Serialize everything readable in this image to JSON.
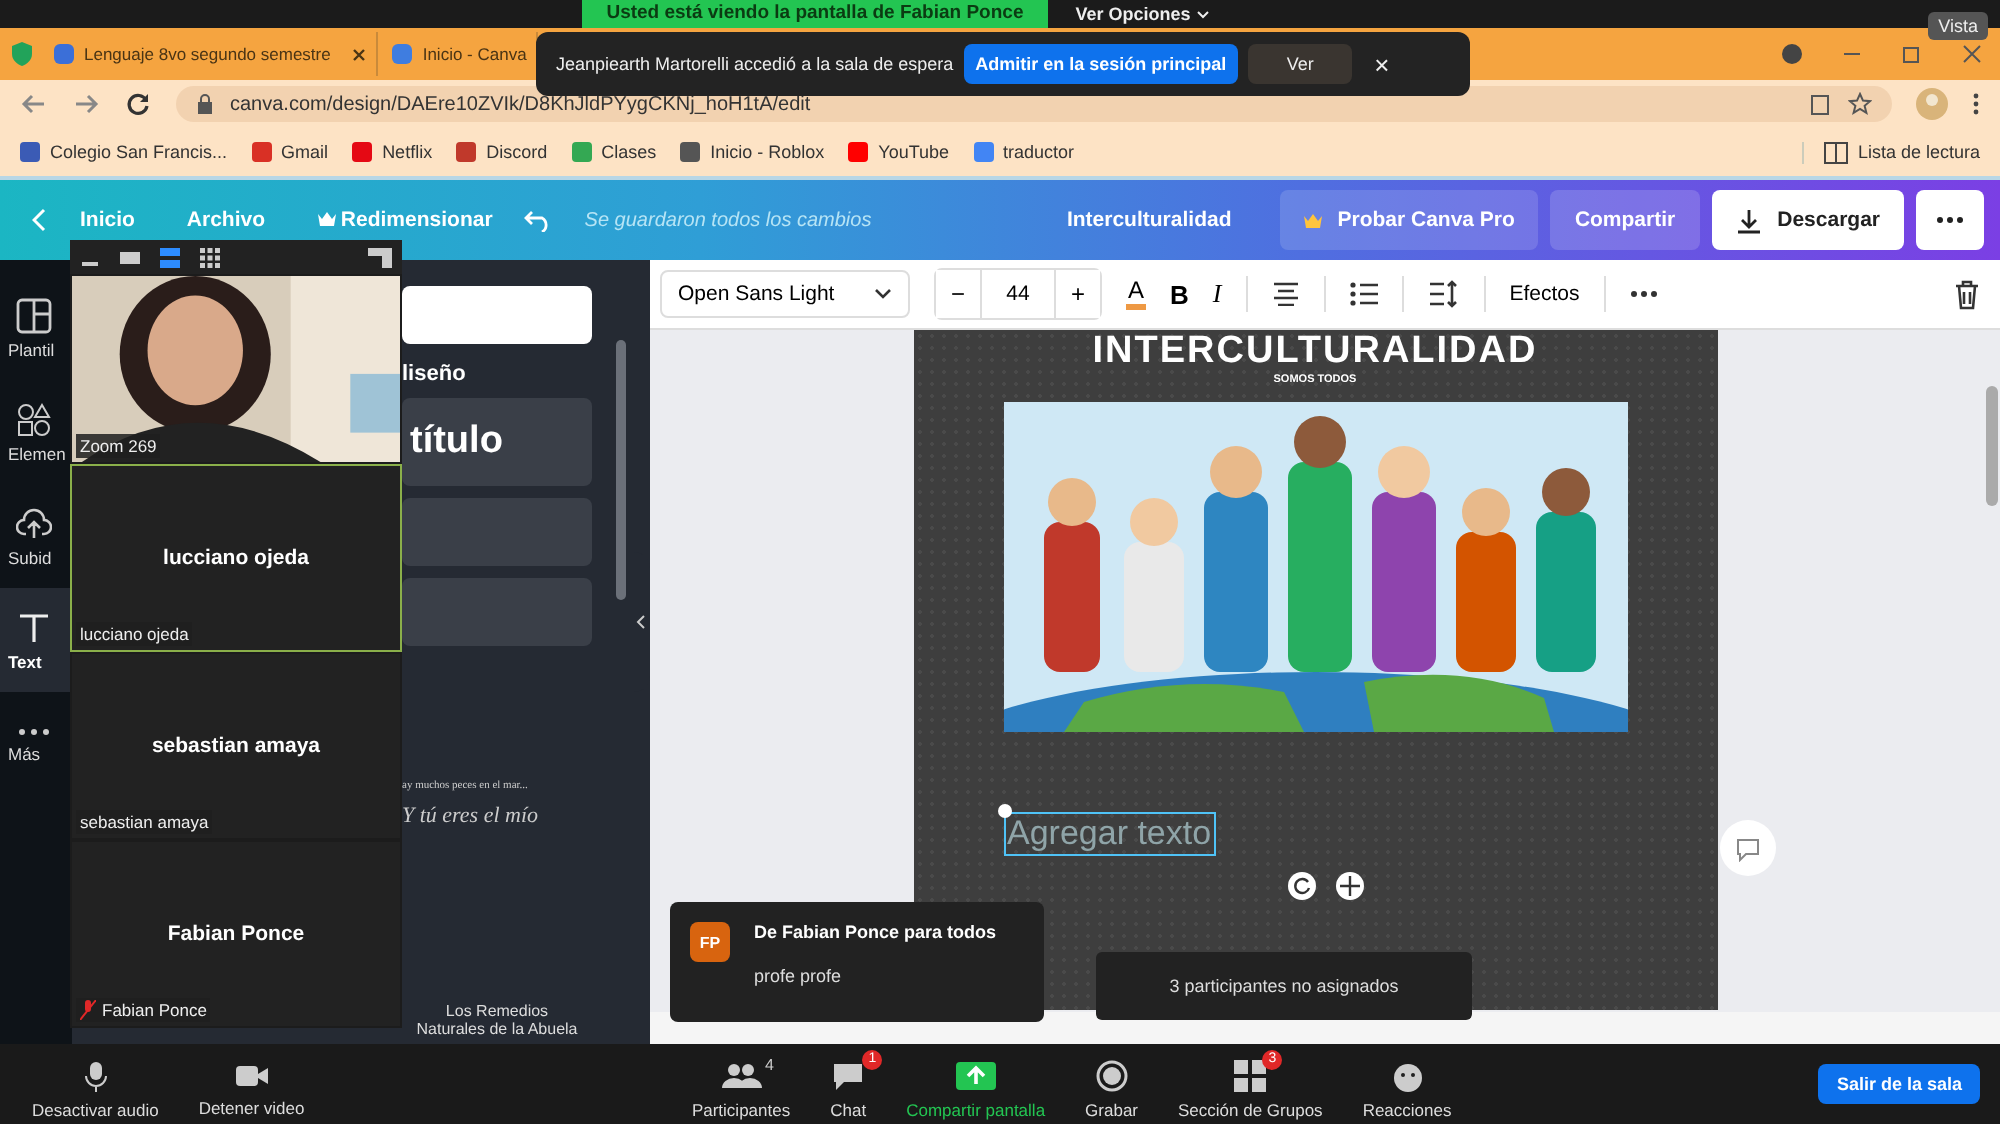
{
  "zoom_top": {
    "banner": "Usted está viendo la pantalla de Fabian Ponce",
    "options": "Ver Opciones",
    "view": "Vista"
  },
  "notification": {
    "message": "Jeanpiearth Martorelli accedió a la sala de espera",
    "admit": "Admitir en la sesión principal",
    "view": "Ver",
    "close": "×"
  },
  "browser": {
    "tabs": [
      {
        "title": "Lenguaje 8vo segundo semestre",
        "selected": false,
        "color": "#3b6fd8",
        "close_visible": true
      },
      {
        "title": "Inicio - Canva",
        "selected": false,
        "color": "#3f7de0",
        "close_visible": false
      }
    ],
    "url": "canva.com/design/DAEre10ZVIk/D8KhJldPYygCKNj_hoH1tA/edit",
    "bookmarks": [
      {
        "label": "Colegio San Francis...",
        "color": "#3b5bb5"
      },
      {
        "label": "Gmail",
        "color": "#d93025"
      },
      {
        "label": "Netflix",
        "color": "#e50914"
      },
      {
        "label": "Discord",
        "color": "#c0392b"
      },
      {
        "label": "Clases",
        "color": "#34a853"
      },
      {
        "label": "Inicio - Roblox",
        "color": "#555555"
      },
      {
        "label": "YouTube",
        "color": "#ff0000"
      },
      {
        "label": "traductor",
        "color": "#4285f4"
      }
    ],
    "reading_list": "Lista de lectura"
  },
  "canva": {
    "nav": [
      "Inicio",
      "Archivo",
      "Redimensionar"
    ],
    "saved": "Se guardaron todos los cambios",
    "doc_title": "Interculturalidad",
    "pro": "Probar Canva Pro",
    "share": "Compartir",
    "download": "Descargar"
  },
  "sidebar": {
    "items": [
      {
        "label": "Plantil",
        "kind": "templates",
        "selected": false
      },
      {
        "label": "Elemen",
        "kind": "elements",
        "selected": false
      },
      {
        "label": "Subid",
        "kind": "uploads",
        "selected": false
      },
      {
        "label": "Text",
        "kind": "text",
        "selected": true
      },
      {
        "label": "Más",
        "kind": "more",
        "selected": false
      }
    ]
  },
  "panel": {
    "heading": "liseño",
    "title_sample": "título",
    "sample_small": "ay muchos peces en el mar...",
    "sample_script": "Y tú eres el mío",
    "remedies": [
      "Los Remedios",
      "Naturales de la Abuela"
    ]
  },
  "toolbar": {
    "font": "Open Sans Light",
    "minus": "−",
    "size": "44",
    "plus": "+",
    "color_letter": "A",
    "bold": "B",
    "italic": "I",
    "effects": "Efectos"
  },
  "page": {
    "title": "INTERCULTURALIDAD",
    "subtitle": "SOMOS TODOS",
    "textbox": "Agregar texto"
  },
  "gallery": {
    "tiles": [
      {
        "kind": "video",
        "label": "Zoom 269",
        "selected": false,
        "muted": false
      },
      {
        "kind": "name",
        "name": "lucciano ojeda",
        "label": "lucciano ojeda",
        "selected": true,
        "muted": false
      },
      {
        "kind": "name",
        "name": "sebastian amaya",
        "label": "sebastian amaya",
        "selected": false,
        "muted": false
      },
      {
        "kind": "name",
        "name": "Fabian Ponce",
        "label": "Fabian Ponce",
        "selected": false,
        "muted": true
      }
    ]
  },
  "chat_popup": {
    "initials": "FP",
    "from": "De Fabian Ponce para todos",
    "message": "profe profe"
  },
  "tooltip": "3 participantes no asignados",
  "zoom_bar": {
    "left": [
      {
        "kind": "mic",
        "label": "Desactivar audio"
      },
      {
        "kind": "camera",
        "label": "Detener video"
      }
    ],
    "center": [
      {
        "kind": "participants",
        "label": "Participantes",
        "count": "4"
      },
      {
        "kind": "chat",
        "label": "Chat",
        "badge": "1"
      },
      {
        "kind": "share",
        "label": "Compartir pantalla"
      },
      {
        "kind": "record",
        "label": "Grabar"
      },
      {
        "kind": "rooms",
        "label": "Sección de Grupos",
        "badge": "3"
      },
      {
        "kind": "reactions",
        "label": "Reacciones"
      }
    ],
    "leave": "Salir de la sala"
  }
}
